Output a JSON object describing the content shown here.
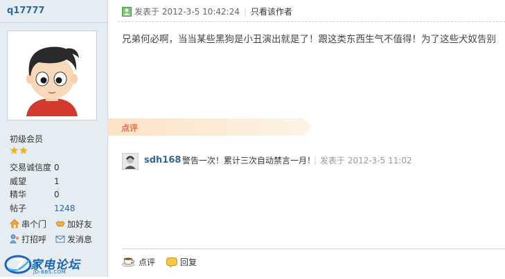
{
  "sidebar": {
    "username": "q17777",
    "level": "初级会员",
    "stars": 2,
    "stats": [
      {
        "label": "交易诚信度",
        "value": "0",
        "link": false
      },
      {
        "label": "威望",
        "value": "1",
        "link": false
      },
      {
        "label": "精华",
        "value": "0",
        "link": false
      },
      {
        "label": "帖子",
        "value": "1248",
        "link": true
      }
    ],
    "actions": {
      "visit": "串个门",
      "add_friend": "加好友",
      "greet": "打招呼",
      "message": "发消息"
    },
    "logo": {
      "text": "家电论坛",
      "subtext": "JD-BBS.COM"
    }
  },
  "post": {
    "posted_label": "发表于 2012-3-5 10:42:24",
    "only_author": "只看该作者",
    "content": "兄弟何必啊，当当某些黑狗是小丑演出就是了！跟这类东西生气不值得！为了这些犬奴告别"
  },
  "dianping": {
    "title": "点评",
    "comment": {
      "user": "sdh168",
      "text": "警告一次！累计三次自动禁言一月！",
      "time": "发表于 2012-3-5 11:02"
    }
  },
  "footer": {
    "dianping_label": "点评",
    "reply_label": "回复"
  },
  "colors": {
    "sidebar_bg": "#e5edf2",
    "border": "#c2d5e3",
    "link": "#336699",
    "banner": "#fdf0de",
    "banner_text": "#f26c4f"
  }
}
